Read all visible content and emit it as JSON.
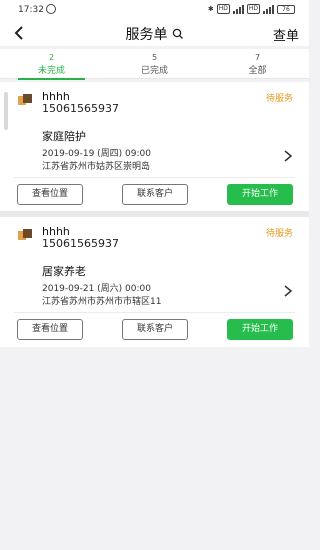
{
  "status_bar": {
    "time": "17:32",
    "hd1": "HD",
    "hd2": "HD",
    "battery": "76"
  },
  "header": {
    "title": "服务单",
    "query_label": "查单",
    "back_icon": "chevron-left-icon",
    "search_icon": "search-icon"
  },
  "tabs": [
    {
      "count": "2",
      "label": "未完成",
      "active": true
    },
    {
      "count": "5",
      "label": "已完成",
      "active": false
    },
    {
      "count": "7",
      "label": "全部",
      "active": false
    }
  ],
  "orders": [
    {
      "name": "hhhh",
      "phone": "15061565937",
      "status": "待服务",
      "service": "家庭陪护",
      "datetime": "2019-09-19 (周四) 09:00",
      "address": "江苏省苏州市姑苏区崇明岛",
      "buttons": {
        "location": "查看位置",
        "contact": "联系客户",
        "start": "开始工作"
      }
    },
    {
      "name": "hhhh",
      "phone": "15061565937",
      "status": "待服务",
      "service": "居家养老",
      "datetime": "2019-09-21 (周六) 00:00",
      "address": "江苏省苏州市苏州市市辖区11",
      "buttons": {
        "location": "查看位置",
        "contact": "联系客户",
        "start": "开始工作"
      }
    }
  ],
  "colors": {
    "accent": "#27b24a",
    "status": "#e69a1d",
    "primary_button": "#26bd4d"
  }
}
